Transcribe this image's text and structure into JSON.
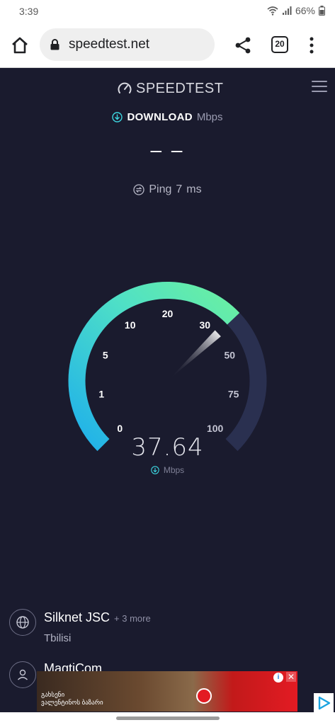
{
  "status_bar": {
    "time": "3:39",
    "battery": "66%"
  },
  "browser": {
    "url": "speedtest.net",
    "tab_count": "20"
  },
  "app": {
    "logo_text": "SPEEDTEST"
  },
  "download": {
    "label": "DOWNLOAD",
    "unit": "Mbps",
    "value": "– –"
  },
  "ping": {
    "label": "Ping",
    "value": "7",
    "unit": "ms"
  },
  "gauge": {
    "ticks": [
      "0",
      "1",
      "5",
      "10",
      "20",
      "30",
      "50",
      "75",
      "100"
    ],
    "reading": "37.64",
    "unit": "Mbps",
    "needle_value": 37.64,
    "colors": {
      "start": "#21b6e8",
      "end": "#6bf0a1",
      "track": "#2a3050"
    }
  },
  "servers": [
    {
      "name": "Silknet JSC",
      "more": "+ 3 more",
      "location": "Tbilisi",
      "icon": "globe-icon"
    },
    {
      "name": "MagtiCom",
      "icon": "person-icon"
    }
  ],
  "ad": {
    "text": "გახსენი ვალენტინოს ბაზარი"
  }
}
